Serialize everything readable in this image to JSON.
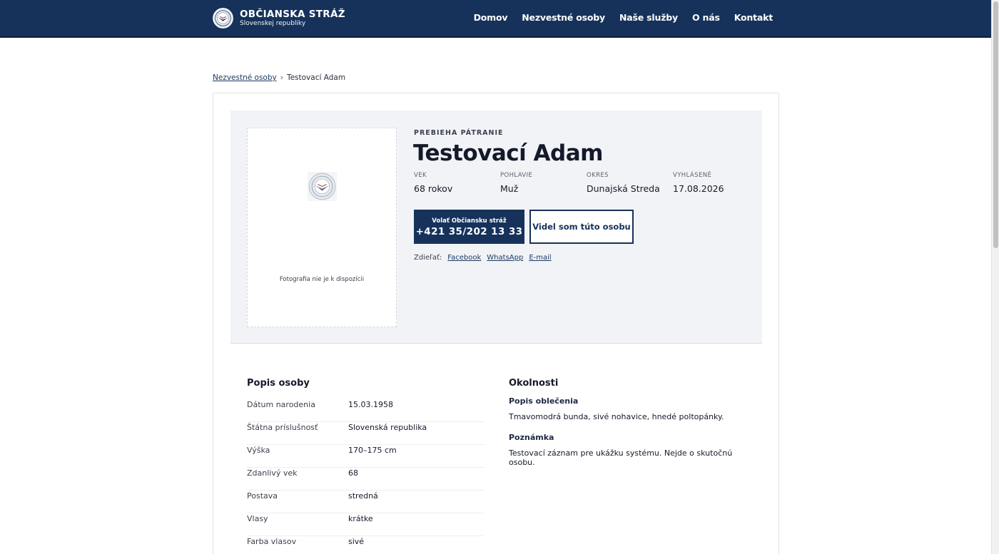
{
  "header": {
    "brand_title": "OBČIANSKA STRÁŽ",
    "brand_subtitle": "Slovenskej republiky",
    "nav": [
      "Domov",
      "Nezvestné osoby",
      "Naše služby",
      "O nás",
      "Kontakt"
    ]
  },
  "breadcrumb": {
    "parent": "Nezvestné osoby",
    "separator": "›",
    "current": "Testovací Adam"
  },
  "hero": {
    "photo_caption": "Fotografia nie je k dispozícii",
    "status": "PREBIEHA PÁTRANIE",
    "name": "Testovací Adam",
    "facts": [
      {
        "label": "VEK",
        "value": "68 rokov"
      },
      {
        "label": "POHLAVIE",
        "value": "Muž"
      },
      {
        "label": "OKRES",
        "value": "Dunajská Streda"
      },
      {
        "label": "VYHLÁSENÉ",
        "value": "17.08.2026"
      }
    ],
    "call_label": "Volať Občiansku stráž",
    "call_number": "+421 35/202 13 33",
    "seen_label": "Videl som túto osobu",
    "share_label": "Zdieľať:",
    "share_links": [
      "Facebook",
      "WhatsApp",
      "E-mail"
    ]
  },
  "description": {
    "title": "Popis osoby",
    "rows": [
      {
        "label": "Dátum narodenia",
        "value": "15.03.1958"
      },
      {
        "label": "Štátna príslušnosť",
        "value": "Slovenská republika"
      },
      {
        "label": "Výška",
        "value": "170–175 cm"
      },
      {
        "label": "Zdanlivý vek",
        "value": "68"
      },
      {
        "label": "Postava",
        "value": "stredná"
      },
      {
        "label": "Vlasy",
        "value": "krátke"
      },
      {
        "label": "Farba vlasov",
        "value": "sivé"
      }
    ]
  },
  "circumstances": {
    "title": "Okolnosti",
    "clothing_title": "Popis oblečenia",
    "clothing_text": "Tmavomodrá bunda, sivé nohavice, hnedé poltopánky.",
    "note_title": "Poznámka",
    "note_text": "Testovací záznam pre ukážku systému. Nejde o skutočnú osobu."
  },
  "colors": {
    "primary": "#16325b",
    "hero_bg": "#f1f3f6"
  }
}
